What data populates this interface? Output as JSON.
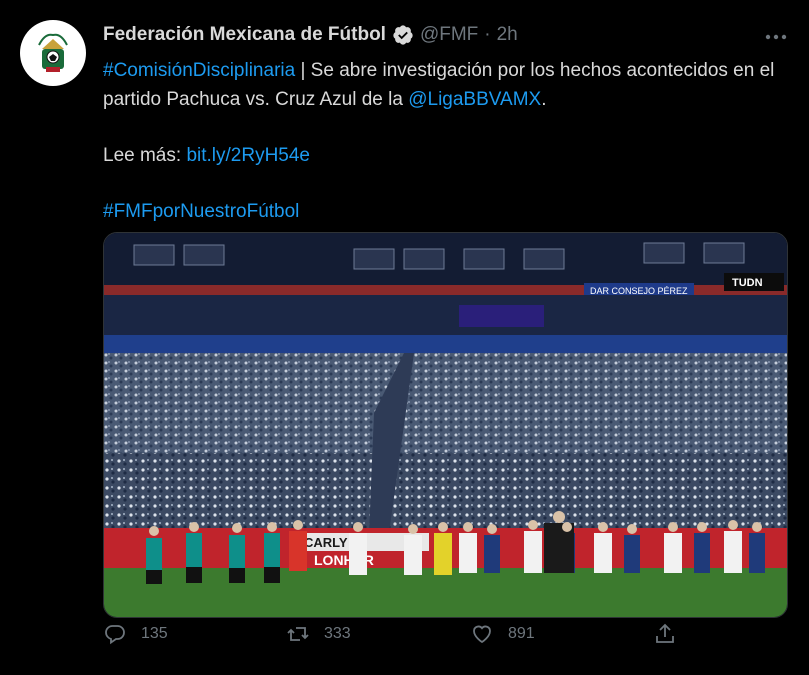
{
  "account": {
    "display_name": "Federación Mexicana de Fútbol",
    "handle": "@FMF",
    "separator": "·",
    "time": "2h",
    "avatar_icon": "fmf-crest-icon",
    "verified_icon": "verified-badge-icon"
  },
  "more_icon": "more-options-icon",
  "tweet": {
    "hashtag1": "#ComisiónDisciplinaria",
    "text1": " | Se abre investigación por los hechos acontecidos en el partido Pachuca vs. Cruz Azul de la ",
    "mention": "@LigaBBVAMX",
    "text1_end": ".",
    "read_more_label": "Lee más: ",
    "read_more_link": "bit.ly/2RyH54e",
    "hashtag2": "#FMFporNuestroFútbol"
  },
  "media": {
    "description_icon": "stadium-photo",
    "banner_text_1": "DAR CONSEJO PÉREZ",
    "banner_text_2": "TUDN",
    "banner_text_3": "CARLY",
    "banner_text_4": "LONHAR"
  },
  "actions": {
    "reply_count": "135",
    "retweet_count": "333",
    "like_count": "891"
  },
  "colors": {
    "background": "#000000",
    "link": "#1d9bf0",
    "muted": "#6e767d",
    "text": "#d9d9d9"
  }
}
